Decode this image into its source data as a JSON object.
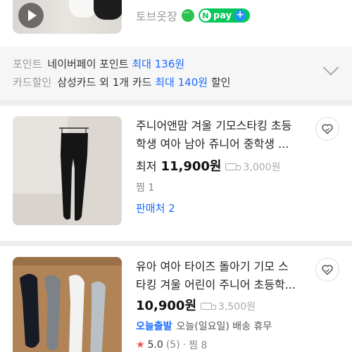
{
  "top_item": {
    "seller": "토브옷장",
    "npay_label": "pay"
  },
  "benefits": {
    "point_key": "포인트",
    "point_text": "네이버페이 포인트",
    "point_hl": "최대 136원",
    "card_key": "카드할인",
    "card_text": "삼성카드 외 1개 카드",
    "card_hl": "최대 140원",
    "card_suffix": "할인"
  },
  "products": [
    {
      "title_line1": "주니어앤맘 겨울 기모스타킹 초등",
      "title_line2": "학생 여아 남아 쥬니어 중학생 ...",
      "price_label": "최저",
      "price": "11,900원",
      "shipping": "3,000원",
      "zzim": "찜 1",
      "sellers_link": "판매처 2"
    },
    {
      "title_line1": "유아 여아 타이즈 돌아기 기모 스",
      "title_line2": "타킹 겨울 어린이 주니어 초등학...",
      "price": "10,900원",
      "shipping": "3,500원",
      "delivery_tag": "오늘출발",
      "delivery_text": "오늘(일요일) 배송 휴무",
      "rating": "5.0",
      "review_count": "(5)",
      "zzim": "찜 8"
    }
  ],
  "colors": {
    "accent_blue": "#1a6cff",
    "npay_green": "#03c75a",
    "star_red": "#ff4b4b"
  }
}
